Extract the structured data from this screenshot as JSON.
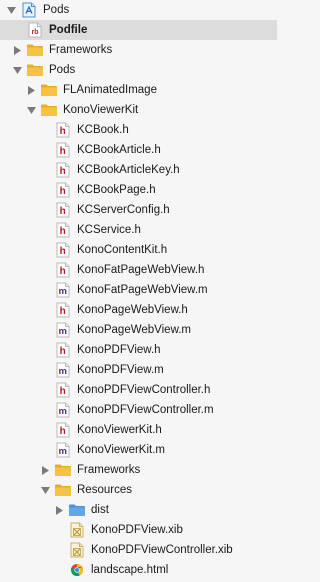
{
  "navigator": {
    "items": [
      {
        "label": "Pods",
        "icon": "project-icon",
        "expanded": true,
        "depth": 0,
        "bold": false,
        "selected": false
      },
      {
        "label": "Podfile",
        "icon": "ruby-file-icon",
        "expanded": null,
        "depth": 1,
        "bold": true,
        "selected": true
      },
      {
        "label": "Frameworks",
        "icon": "folder-icon",
        "expanded": false,
        "depth": 1,
        "bold": false,
        "selected": false
      },
      {
        "label": "Pods",
        "icon": "folder-icon",
        "expanded": true,
        "depth": 1,
        "bold": false,
        "selected": false
      },
      {
        "label": "FLAnimatedImage",
        "icon": "folder-icon",
        "expanded": false,
        "depth": 2,
        "bold": false,
        "selected": false
      },
      {
        "label": "KonoViewerKit",
        "icon": "folder-icon",
        "expanded": true,
        "depth": 2,
        "bold": false,
        "selected": false
      },
      {
        "label": "KCBook.h",
        "icon": "header-file-icon",
        "expanded": null,
        "depth": 3,
        "bold": false,
        "selected": false
      },
      {
        "label": "KCBookArticle.h",
        "icon": "header-file-icon",
        "expanded": null,
        "depth": 3,
        "bold": false,
        "selected": false
      },
      {
        "label": "KCBookArticleKey.h",
        "icon": "header-file-icon",
        "expanded": null,
        "depth": 3,
        "bold": false,
        "selected": false
      },
      {
        "label": "KCBookPage.h",
        "icon": "header-file-icon",
        "expanded": null,
        "depth": 3,
        "bold": false,
        "selected": false
      },
      {
        "label": "KCServerConfig.h",
        "icon": "header-file-icon",
        "expanded": null,
        "depth": 3,
        "bold": false,
        "selected": false
      },
      {
        "label": "KCService.h",
        "icon": "header-file-icon",
        "expanded": null,
        "depth": 3,
        "bold": false,
        "selected": false
      },
      {
        "label": "KonoContentKit.h",
        "icon": "header-file-icon",
        "expanded": null,
        "depth": 3,
        "bold": false,
        "selected": false
      },
      {
        "label": "KonoFatPageWebView.h",
        "icon": "header-file-icon",
        "expanded": null,
        "depth": 3,
        "bold": false,
        "selected": false
      },
      {
        "label": "KonoFatPageWebView.m",
        "icon": "implementation-file-icon",
        "expanded": null,
        "depth": 3,
        "bold": false,
        "selected": false
      },
      {
        "label": "KonoPageWebView.h",
        "icon": "header-file-icon",
        "expanded": null,
        "depth": 3,
        "bold": false,
        "selected": false
      },
      {
        "label": "KonoPageWebView.m",
        "icon": "implementation-file-icon",
        "expanded": null,
        "depth": 3,
        "bold": false,
        "selected": false
      },
      {
        "label": "KonoPDFView.h",
        "icon": "header-file-icon",
        "expanded": null,
        "depth": 3,
        "bold": false,
        "selected": false
      },
      {
        "label": "KonoPDFView.m",
        "icon": "implementation-file-icon",
        "expanded": null,
        "depth": 3,
        "bold": false,
        "selected": false
      },
      {
        "label": "KonoPDFViewController.h",
        "icon": "header-file-icon",
        "expanded": null,
        "depth": 3,
        "bold": false,
        "selected": false
      },
      {
        "label": "KonoPDFViewController.m",
        "icon": "implementation-file-icon",
        "expanded": null,
        "depth": 3,
        "bold": false,
        "selected": false
      },
      {
        "label": "KonoViewerKit.h",
        "icon": "header-file-icon",
        "expanded": null,
        "depth": 3,
        "bold": false,
        "selected": false
      },
      {
        "label": "KonoViewerKit.m",
        "icon": "implementation-file-icon",
        "expanded": null,
        "depth": 3,
        "bold": false,
        "selected": false
      },
      {
        "label": "Frameworks",
        "icon": "folder-icon",
        "expanded": false,
        "depth": 3,
        "bold": false,
        "selected": false
      },
      {
        "label": "Resources",
        "icon": "folder-icon",
        "expanded": true,
        "depth": 3,
        "bold": false,
        "selected": false
      },
      {
        "label": "dist",
        "icon": "blue-folder-icon",
        "expanded": false,
        "depth": 4,
        "bold": false,
        "selected": false
      },
      {
        "label": "KonoPDFView.xib",
        "icon": "xib-file-icon",
        "expanded": null,
        "depth": 4,
        "bold": false,
        "selected": false
      },
      {
        "label": "KonoPDFViewController.xib",
        "icon": "xib-file-icon",
        "expanded": null,
        "depth": 4,
        "bold": false,
        "selected": false
      },
      {
        "label": "landscape.html",
        "icon": "html-file-icon",
        "expanded": null,
        "depth": 4,
        "bold": false,
        "selected": false
      }
    ]
  },
  "colors": {
    "background": "#f6f6f6",
    "selection": "#dcdcdc",
    "folder": "#f5c242",
    "folder_tab": "#e6ad2d",
    "blue_folder": "#5fa9e8",
    "header_letter": "#b21c2c",
    "implementation_letter": "#4b2d7f",
    "ruby_red": "#c4213b",
    "disclosure": "#7a7a7a"
  }
}
